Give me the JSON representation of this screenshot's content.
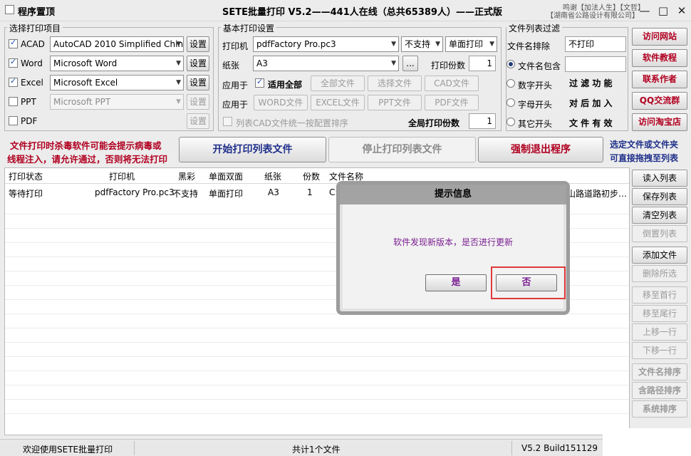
{
  "titlebar": {
    "checkbox_label": "程序置顶",
    "title": "SETE批量打印 V5.2——441人在线（总共65389人）——正式版",
    "credit_line1": "鸣谢【加法人生】【文哲】",
    "credit_line2": "【湖南省公路设计有限公司】",
    "min": "—",
    "max": "□",
    "close": "✕"
  },
  "print_items": {
    "title": "选择打印项目",
    "items": [
      {
        "label": "ACAD",
        "checked": true,
        "enabled": true,
        "program": "AutoCAD 2010 Simplified Chin",
        "settings": "设置"
      },
      {
        "label": "Word",
        "checked": true,
        "enabled": true,
        "program": "Microsoft Word",
        "settings": "设置"
      },
      {
        "label": "Excel",
        "checked": true,
        "enabled": true,
        "program": "Microsoft Excel",
        "settings": "设置"
      },
      {
        "label": "PPT",
        "checked": false,
        "enabled": false,
        "program": "Microsoft PPT",
        "settings": "设置"
      },
      {
        "label": "PDF",
        "checked": false,
        "enabled": false,
        "program": "",
        "settings": "设置"
      }
    ]
  },
  "basic_settings": {
    "title": "基本打印设置",
    "printer_label": "打印机",
    "printer_value": "pdfFactory Pro.pc3",
    "color_value": "不支持",
    "duplex_value": "单面打印",
    "paper_label": "纸张",
    "paper_value": "A3",
    "browse": "...",
    "copies_label": "打印份数",
    "copies_value": "1",
    "apply_label": "应用于",
    "apply_all": "适用全部",
    "row1_buttons": [
      "全部文件",
      "选择文件",
      "CAD文件"
    ],
    "apply_label2": "应用于",
    "row2_buttons": [
      "WORD文件",
      "EXCEL文件",
      "PPT文件",
      "PDF文件"
    ],
    "sort_cad": "列表CAD文件统一按配置排序",
    "global_copies_label": "全局打印份数",
    "global_copies_value": "1"
  },
  "filter": {
    "title": "文件列表过滤",
    "exclude_label": "文件名排除",
    "exclude_value": "不打印",
    "options": [
      "文件名包含",
      "数字开头",
      "字母开头",
      "其它开头"
    ],
    "hint_lines": [
      "过 滤 功 能",
      "对 后 加 入",
      "文 件 有 效"
    ]
  },
  "side_buttons": [
    "访问网站",
    "软件教程",
    "联系作者",
    "QQ交流群",
    "访问淘宝店"
  ],
  "warning": {
    "line1": "文件打印时杀毒软件可能会提示病毒或",
    "line2": "线程注入，请允许通过，否则将无法打印"
  },
  "actions": {
    "start": "开始打印列表文件",
    "stop": "停止打印列表文件",
    "force_exit": "强制退出程序"
  },
  "drag_hint": {
    "line1": "选定文件或文件夹",
    "line2": "可直接拖拽至列表"
  },
  "list": {
    "columns": [
      "打印状态",
      "打印机",
      "黑彩",
      "单面双面",
      "纸张",
      "份数",
      "文件名称"
    ],
    "rows": [
      {
        "status": "等待打印",
        "printer": "pdfFactory Pro.pc3",
        "color": "不支持",
        "duplex": "单面打印",
        "paper": "A3",
        "copies": "1",
        "file_start": "C:\\",
        "file_end": "山路道路初步…"
      }
    ]
  },
  "list_buttons": [
    {
      "label": "读入列表",
      "enabled": true
    },
    {
      "label": "保存列表",
      "enabled": true
    },
    {
      "label": "清空列表",
      "enabled": true
    },
    {
      "label": "倒置列表",
      "enabled": false
    },
    {
      "label": "添加文件",
      "enabled": true
    },
    {
      "label": "删除所选",
      "enabled": false
    },
    {
      "label": "移至首行",
      "enabled": false
    },
    {
      "label": "移至尾行",
      "enabled": false
    },
    {
      "label": "上移一行",
      "enabled": false
    },
    {
      "label": "下移一行",
      "enabled": false
    },
    {
      "label": "文件名排序",
      "enabled": false
    },
    {
      "label": "含路径排序",
      "enabled": false
    },
    {
      "label": "系统排序",
      "enabled": false
    }
  ],
  "dialog": {
    "title": "提示信息",
    "message": "软件发现新版本，是否进行更新",
    "yes": "是",
    "no": "否"
  },
  "statusbar": {
    "welcome": "欢迎使用SETE批量打印",
    "count": "共计1个文件",
    "version": "V5.2 Build151129"
  }
}
